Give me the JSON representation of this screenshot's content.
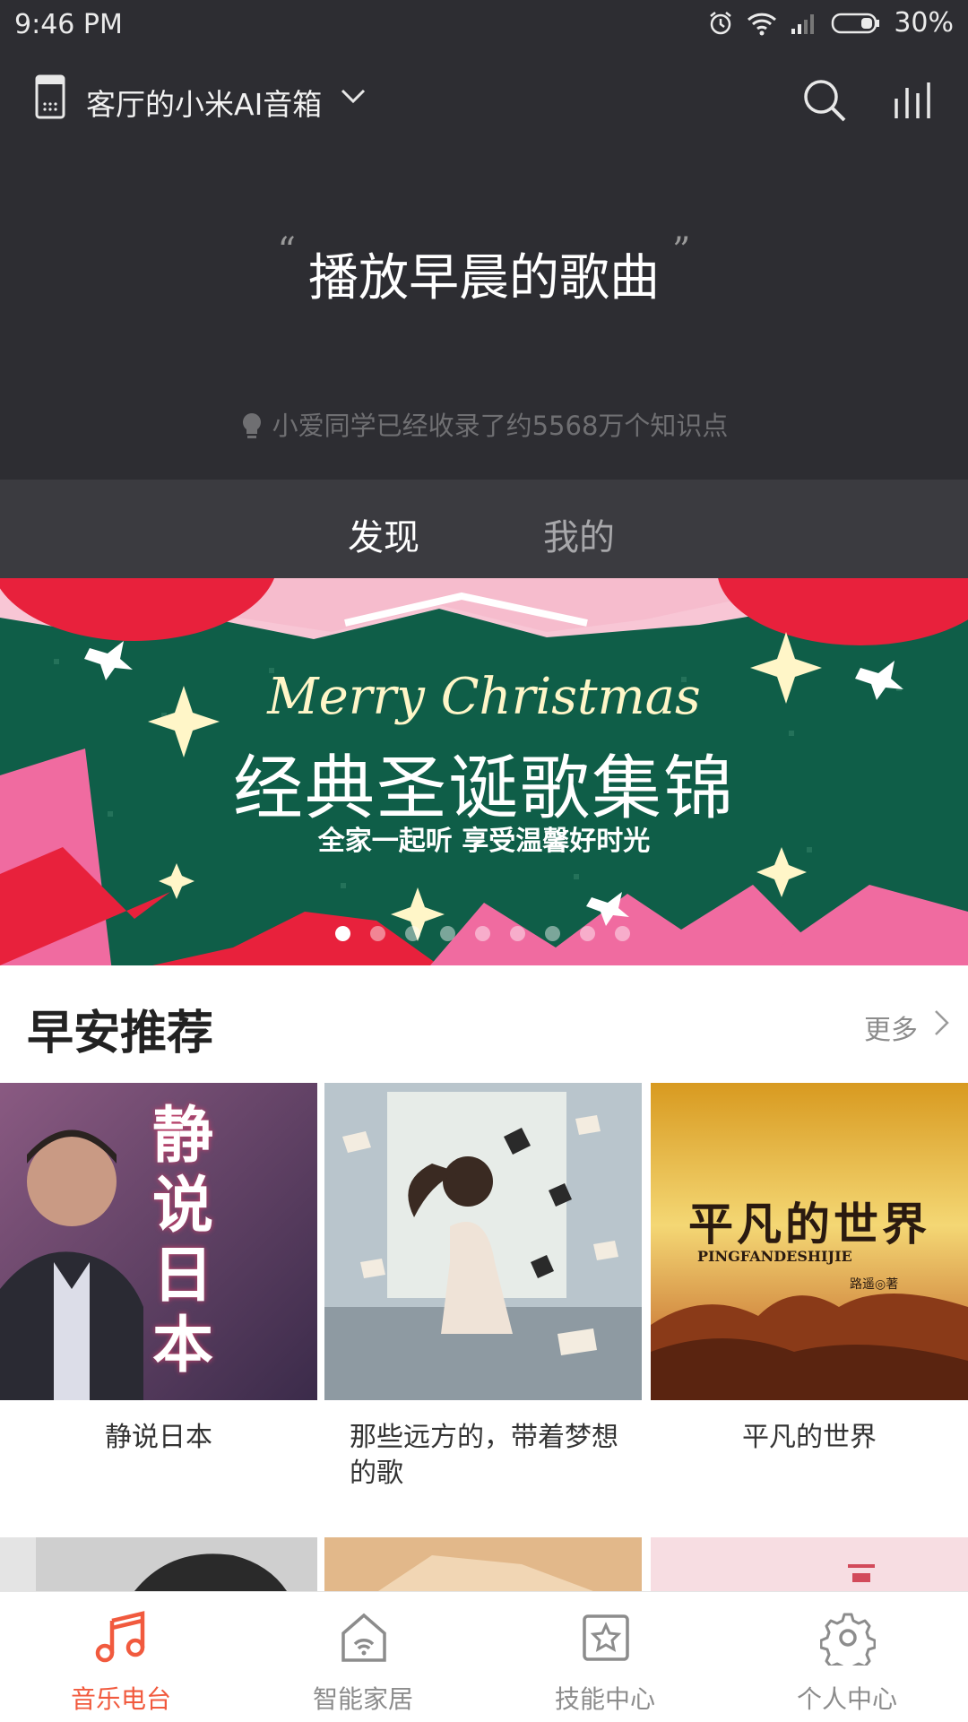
{
  "status_bar": {
    "time": "9:46 PM",
    "battery": "30%"
  },
  "header": {
    "device_name": "客厅的小米AI音箱"
  },
  "hero": {
    "quote": "播放早晨的歌曲",
    "hint": "小爱同学已经收录了约5568万个知识点"
  },
  "tabs": [
    {
      "label": "发现",
      "active": true
    },
    {
      "label": "我的",
      "active": false
    }
  ],
  "banner": {
    "line1": "Merry Christmas",
    "line2": "经典圣诞歌集锦",
    "line3": "全家一起听 享受温馨好时光",
    "page_count": 9,
    "active_index": 0
  },
  "section": {
    "title": "早安推荐",
    "more": "更多"
  },
  "cards": [
    {
      "caption": "静说日本",
      "cover_text": "静说日本"
    },
    {
      "caption": "那些远方的，带着梦想的歌"
    },
    {
      "caption": "平凡的世界",
      "cover_title": "平凡的世界",
      "cover_pinyin": "PINGFANDESHIJIE",
      "cover_author": "路遥◎著"
    }
  ],
  "bottom_nav": [
    {
      "label": "音乐电台",
      "icon": "music-note-icon",
      "active": true
    },
    {
      "label": "智能家居",
      "icon": "smart-home-icon",
      "active": false
    },
    {
      "label": "技能中心",
      "icon": "star-box-icon",
      "active": false
    },
    {
      "label": "个人中心",
      "icon": "gear-icon",
      "active": false
    }
  ],
  "colors": {
    "accent": "#f15a3e",
    "header_bg": "#2d2d32",
    "tab_bg": "#3b3b40",
    "banner_green": "#0f5e48",
    "banner_red": "#e8213c",
    "banner_pink": "#f06ba0"
  }
}
